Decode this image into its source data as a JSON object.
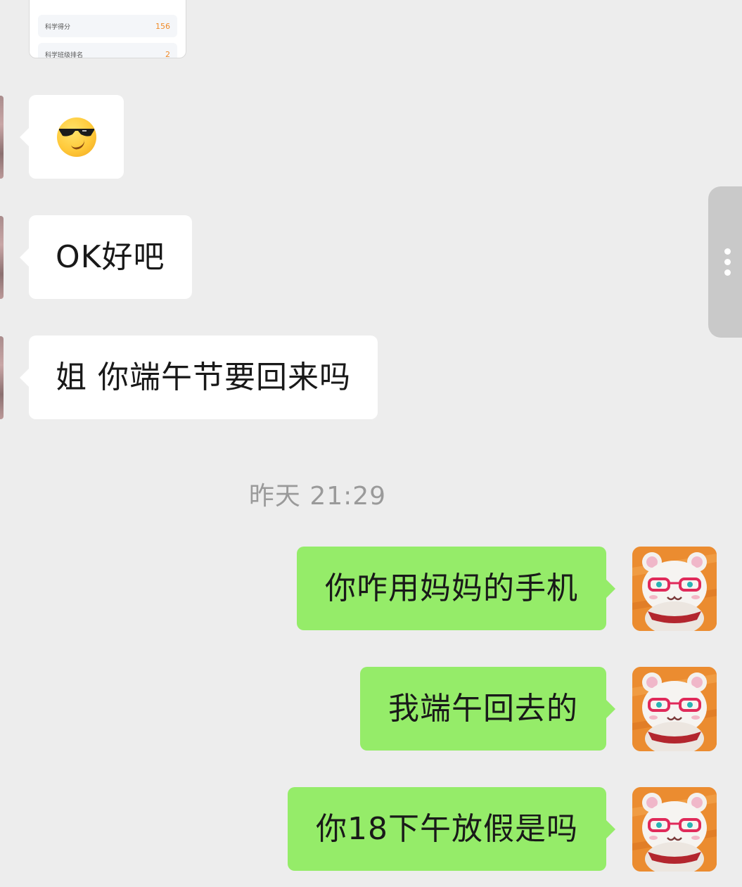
{
  "score_card": {
    "rows": [
      {
        "label": "科学得分",
        "value": "156"
      },
      {
        "label": "科学班级排名",
        "value": "2"
      }
    ]
  },
  "messages_incoming": [
    {
      "type": "emoji",
      "emoji": "sunglasses-smirk-emoji"
    },
    {
      "type": "text",
      "text": "OK好吧"
    },
    {
      "type": "text",
      "text": "姐 你端午节要回来吗"
    }
  ],
  "timestamp": "昨天 21:29",
  "messages_outgoing": [
    {
      "text": "你咋用妈妈的手机"
    },
    {
      "text": "我端午回去的"
    },
    {
      "text": "你18下午放假是吗"
    }
  ],
  "colors": {
    "background": "#ededed",
    "incoming_bubble": "#ffffff",
    "outgoing_bubble": "#95ec69",
    "timestamp_text": "#9a9a9a",
    "score_value": "#f08c2b"
  },
  "icons": {
    "side_handle": "more-vertical-icon",
    "avatar_me": "bear-avatar-icon"
  }
}
